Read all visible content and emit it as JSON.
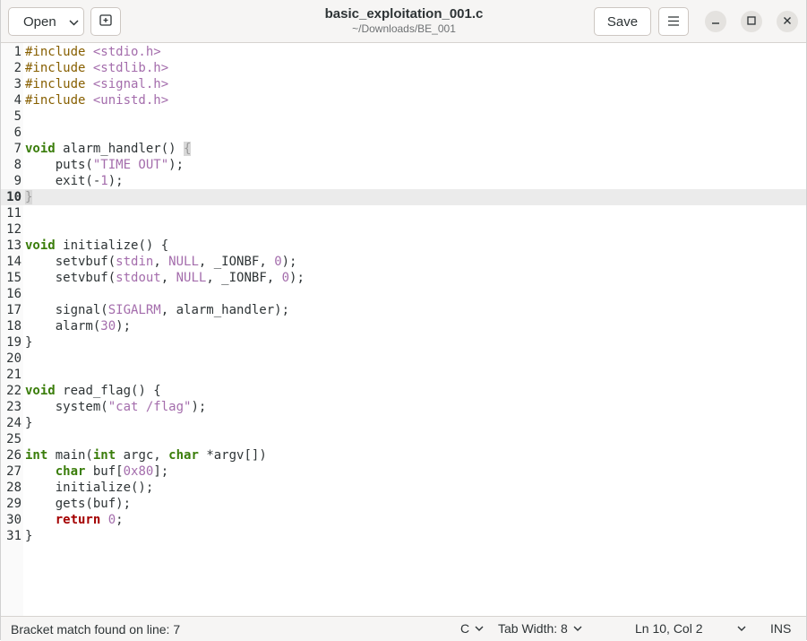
{
  "header": {
    "open_label": "Open",
    "title": "basic_exploitation_001.c",
    "subtitle": "~/Downloads/BE_001",
    "save_label": "Save"
  },
  "icons": {
    "open_dropdown": "chevron-down-icon",
    "new_tab": "new-tab-icon",
    "menu": "hamburger-menu-icon",
    "minimize": "minimize-icon",
    "maximize": "maximize-icon",
    "close": "close-icon"
  },
  "editor": {
    "current_line": 10,
    "lines": [
      {
        "n": "1",
        "t": [
          [
            "pp",
            "#include "
          ],
          [
            "inc",
            "<stdio.h>"
          ]
        ]
      },
      {
        "n": "2",
        "t": [
          [
            "pp",
            "#include "
          ],
          [
            "inc",
            "<stdlib.h>"
          ]
        ]
      },
      {
        "n": "3",
        "t": [
          [
            "pp",
            "#include "
          ],
          [
            "inc",
            "<signal.h>"
          ]
        ]
      },
      {
        "n": "4",
        "t": [
          [
            "pp",
            "#include "
          ],
          [
            "inc",
            "<unistd.h>"
          ]
        ]
      },
      {
        "n": "5",
        "t": []
      },
      {
        "n": "6",
        "t": []
      },
      {
        "n": "7",
        "t": [
          [
            "kw",
            "void"
          ],
          [
            "",
            "alarm_handler() "
          ],
          [
            "bm",
            "{"
          ]
        ]
      },
      {
        "n": "8",
        "t": [
          [
            "",
            "    puts("
          ],
          [
            "str",
            "\"TIME OUT\""
          ],
          [
            "",
            ");"
          ]
        ]
      },
      {
        "n": "9",
        "t": [
          [
            "",
            "    exit(-"
          ],
          [
            "num",
            "1"
          ],
          [
            "",
            ");"
          ]
        ]
      },
      {
        "n": "10",
        "t": [
          [
            "bm",
            "}"
          ]
        ]
      },
      {
        "n": "11",
        "t": []
      },
      {
        "n": "12",
        "t": []
      },
      {
        "n": "13",
        "t": [
          [
            "kw",
            "void"
          ],
          [
            "",
            "initialize() {"
          ]
        ]
      },
      {
        "n": "14",
        "t": [
          [
            "",
            "    setvbuf("
          ],
          [
            "str",
            "stdin"
          ],
          [
            "",
            ", "
          ],
          [
            "str",
            "NULL"
          ],
          [
            "",
            ", _IONBF, "
          ],
          [
            "num",
            "0"
          ],
          [
            "",
            ");"
          ]
        ]
      },
      {
        "n": "15",
        "t": [
          [
            "",
            "    setvbuf("
          ],
          [
            "str",
            "stdout"
          ],
          [
            "",
            ", "
          ],
          [
            "str",
            "NULL"
          ],
          [
            "",
            ", _IONBF, "
          ],
          [
            "num",
            "0"
          ],
          [
            "",
            ");"
          ]
        ]
      },
      {
        "n": "16",
        "t": []
      },
      {
        "n": "17",
        "t": [
          [
            "",
            "    signal("
          ],
          [
            "str",
            "SIGALRM"
          ],
          [
            "",
            ", alarm_handler);"
          ]
        ]
      },
      {
        "n": "18",
        "t": [
          [
            "",
            "    alarm("
          ],
          [
            "num",
            "30"
          ],
          [
            "",
            ");"
          ]
        ]
      },
      {
        "n": "19",
        "t": [
          [
            "",
            "}"
          ]
        ]
      },
      {
        "n": "20",
        "t": []
      },
      {
        "n": "21",
        "t": []
      },
      {
        "n": "22",
        "t": [
          [
            "kw",
            "void"
          ],
          [
            "",
            "read_flag() {"
          ]
        ]
      },
      {
        "n": "23",
        "t": [
          [
            "",
            "    system("
          ],
          [
            "str",
            "\"cat /flag\""
          ],
          [
            "",
            ");"
          ]
        ]
      },
      {
        "n": "24",
        "t": [
          [
            "",
            "}"
          ]
        ]
      },
      {
        "n": "25",
        "t": []
      },
      {
        "n": "26",
        "t": [
          [
            "kw",
            "int"
          ],
          [
            "",
            "main("
          ],
          [
            "kw",
            "int"
          ],
          [
            "",
            "argc, "
          ],
          [
            "kw",
            "char"
          ],
          [
            "",
            "*argv[])"
          ]
        ]
      },
      {
        "n": "27",
        "t": [
          [
            "",
            "    "
          ],
          [
            "kw",
            "char"
          ],
          [
            "",
            "buf["
          ],
          [
            "num",
            "0x80"
          ],
          [
            "",
            "];"
          ]
        ]
      },
      {
        "n": "28",
        "t": [
          [
            "",
            "    initialize();"
          ]
        ]
      },
      {
        "n": "29",
        "t": [
          [
            "",
            "    gets(buf);"
          ]
        ]
      },
      {
        "n": "30",
        "t": [
          [
            "",
            "    "
          ],
          [
            "kwr",
            "return"
          ],
          [
            "",
            ""
          ],
          [
            "num",
            "0"
          ],
          [
            "",
            ";"
          ]
        ]
      },
      {
        "n": "31",
        "t": [
          [
            "",
            "}"
          ]
        ]
      }
    ]
  },
  "status": {
    "message": "Bracket match found on line: 7",
    "language": "C",
    "tab_width": "Tab Width: 8",
    "position": "Ln 10, Col 2",
    "mode": "INS"
  }
}
